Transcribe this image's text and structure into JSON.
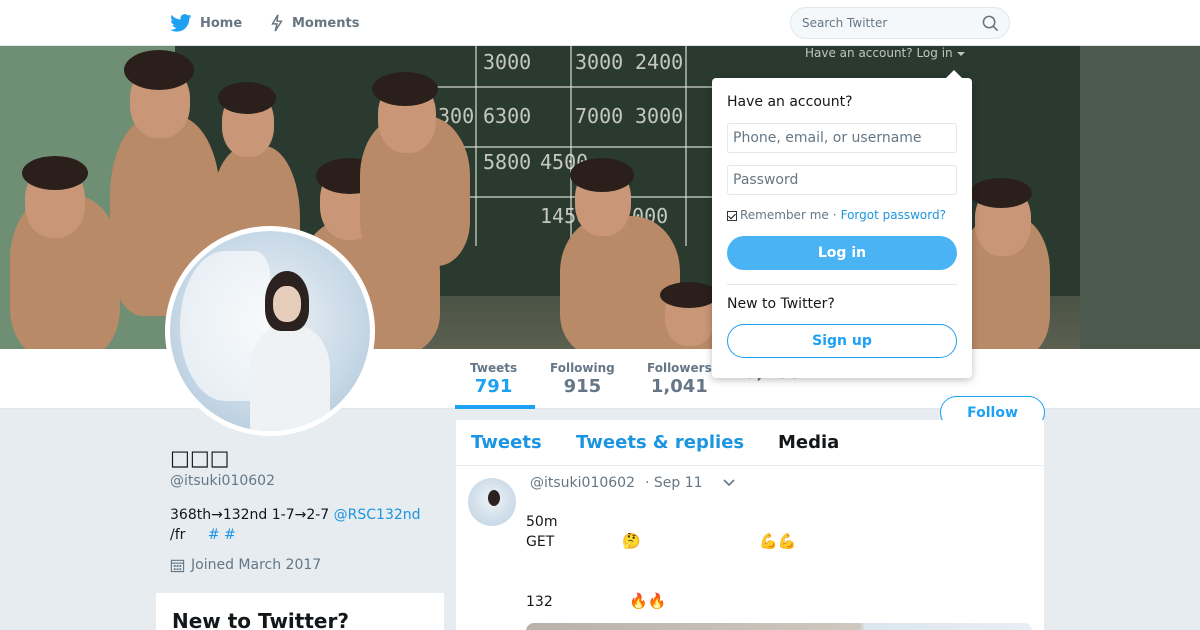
{
  "nav": {
    "home_label": "Home",
    "moments_label": "Moments",
    "search_placeholder": "Search Twitter",
    "account_hint": "Have an account? Log in"
  },
  "profile": {
    "name": "□□□",
    "handle": "@itsuki010602",
    "bio_line1": "368th→132nd 1-7→2-7 ",
    "bio_mention": "@RSC132nd",
    "bio_line2": "/fr",
    "bio_hashtags": "# #",
    "joined": "Joined March 2017",
    "follow_label": "Follow"
  },
  "stats": [
    {
      "label": "Tweets",
      "value": "791"
    },
    {
      "label": "Following",
      "value": "915"
    },
    {
      "label": "Followers",
      "value": "1,041"
    },
    {
      "label": "",
      "value": "5,186"
    }
  ],
  "timeline": {
    "tabs": [
      "Tweets",
      "Tweets & replies",
      "Media"
    ],
    "tweet": {
      "handle": "@itsuki010602",
      "time": "· Sep 11",
      "line1": "50m",
      "line2": "GET",
      "line3": "132",
      "emoji_think": "🤔",
      "emoji_muscle": "💪💪",
      "emoji_fire": "🔥🔥"
    }
  },
  "sidebar_card": {
    "title": "New to Twitter?"
  },
  "login": {
    "title": "Have an account?",
    "username_placeholder": "Phone, email, or username",
    "password_placeholder": "Password",
    "remember_label": "Remember me",
    "separator": "·",
    "forgot_label": "Forgot password?",
    "login_label": "Log in",
    "new_label": "New to Twitter?",
    "signup_label": "Sign up"
  },
  "banner_text": {
    "row1": [
      "3000",
      "3000",
      "2400"
    ],
    "row2": [
      "300",
      "6300",
      "7000",
      "3000"
    ],
    "row3": [
      "5800",
      "4500"
    ],
    "row4": [
      "1450",
      "7000"
    ]
  },
  "colors": {
    "accent": "#1da1f2",
    "link": "#1b95e0",
    "background": "#e6ecf0"
  }
}
